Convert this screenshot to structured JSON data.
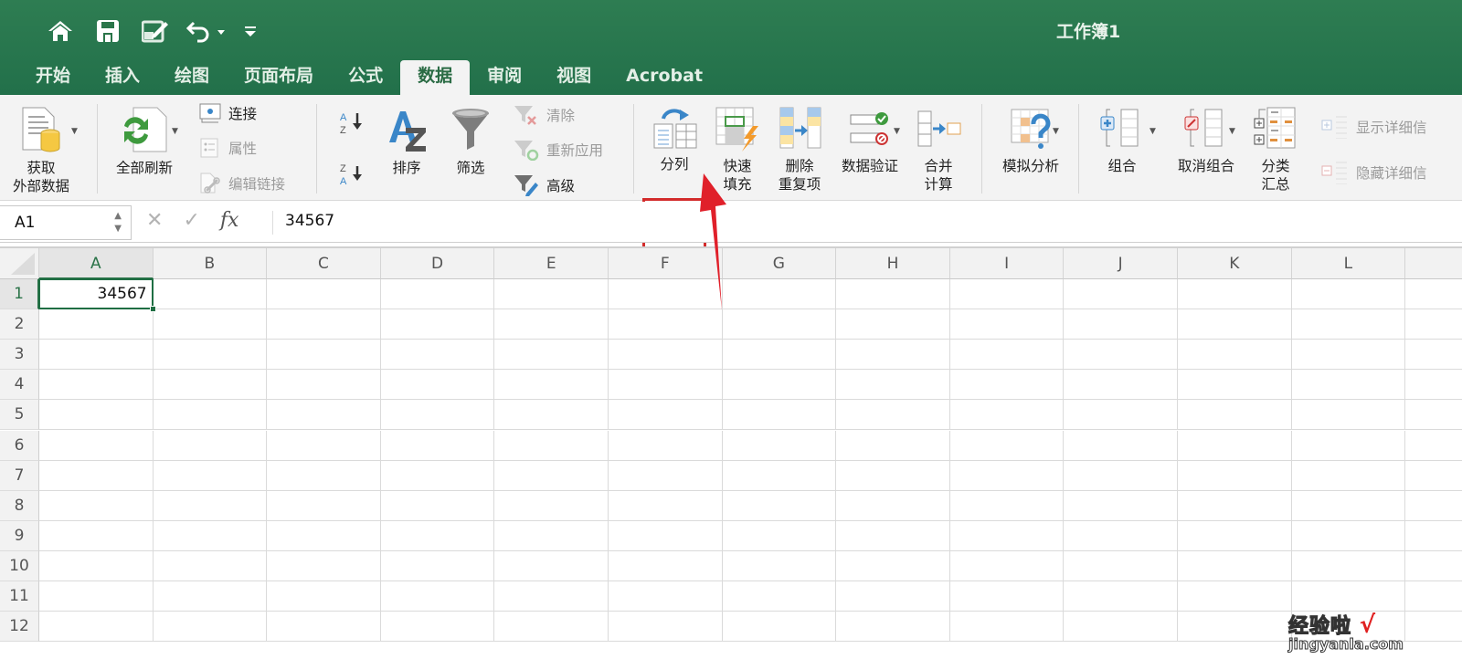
{
  "window": {
    "title": "工作簿1"
  },
  "qat": {
    "icons": [
      "home-icon",
      "save-icon",
      "edit-icon",
      "undo-icon",
      "customize-icon"
    ]
  },
  "tabs": [
    {
      "label": "开始",
      "active": false
    },
    {
      "label": "插入",
      "active": false
    },
    {
      "label": "绘图",
      "active": false
    },
    {
      "label": "页面布局",
      "active": false
    },
    {
      "label": "公式",
      "active": false
    },
    {
      "label": "数据",
      "active": true
    },
    {
      "label": "审阅",
      "active": false
    },
    {
      "label": "视图",
      "active": false
    },
    {
      "label": "Acrobat",
      "active": false
    }
  ],
  "ribbon": {
    "get_external_data": "获取\n外部数据",
    "refresh_all": "全部刷新",
    "connections": "连接",
    "properties": "属性",
    "edit_links": "编辑链接",
    "sort": "排序",
    "filter": "筛选",
    "clear": "清除",
    "reapply": "重新应用",
    "advanced": "高级",
    "text_to_columns": "分列",
    "flash_fill": "快速\n填充",
    "remove_duplicates": "删除\n重复项",
    "data_validation": "数据验证",
    "consolidate": "合并\n计算",
    "what_if": "模拟分析",
    "group": "组合",
    "ungroup": "取消组合",
    "subtotal": "分类\n汇总",
    "show_detail": "显示详细信",
    "hide_detail": "隐藏详细信"
  },
  "formula_bar": {
    "name_box": "A1",
    "fx": "fx",
    "value": "34567"
  },
  "sheet": {
    "columns": [
      "A",
      "B",
      "C",
      "D",
      "E",
      "F",
      "G",
      "H",
      "I",
      "J",
      "K",
      "L"
    ],
    "rows": [
      "1",
      "2",
      "3",
      "4",
      "5",
      "6",
      "7",
      "8",
      "9",
      "10",
      "11",
      "12"
    ],
    "selected_cell": "A1",
    "cells": {
      "A1": "34567"
    }
  },
  "annotation": {
    "highlight_target": "分列",
    "color": "#d32b2b"
  },
  "watermark": {
    "cn": "经验啦",
    "check": "√",
    "en": "jingyanla.com"
  }
}
